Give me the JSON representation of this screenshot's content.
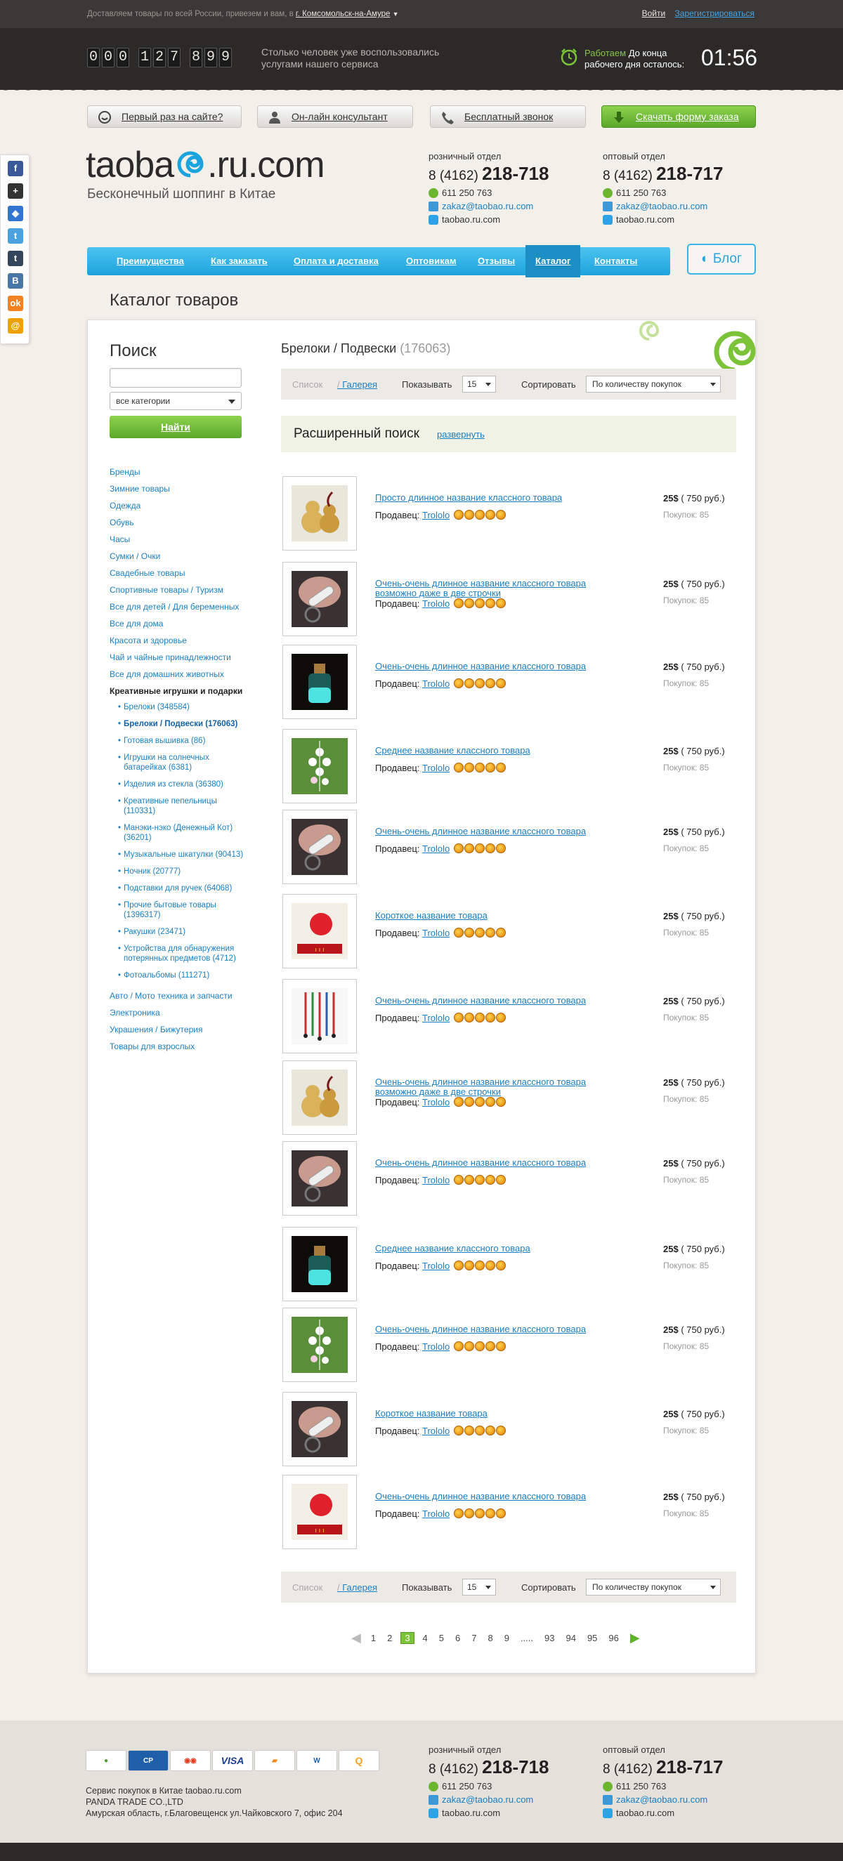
{
  "topbar": {
    "delivery_text": "Доставляем товары по всей России, привезем и вам, в",
    "city": "г. Комсомольск-на-Амуре",
    "login": "Войти",
    "register": "Зарегистрироваться"
  },
  "counter": {
    "digits": [
      "0",
      "0",
      "0",
      "1",
      "2",
      "7",
      "8",
      "9",
      "9"
    ],
    "text_line1": "Столько человек уже воспользовались",
    "text_line2": "услугами нашего сервиса",
    "work_status": "Работаем",
    "work_text_line1": "До конца",
    "work_text_line2": "рабочего дня осталось:",
    "timer": "01:56"
  },
  "quick_buttons": {
    "first_time": "Первый раз на сайте?",
    "consultant": "Он-лайн консультант",
    "free_call": "Бесплатный звонок",
    "order_form": "Скачать форму заказа"
  },
  "logo": {
    "text_before": "taoba",
    "text_after": ".ru.com",
    "tagline": "Бесконечный шоппинг в Китае"
  },
  "contacts": [
    {
      "label": "розничный отдел",
      "phone_prefix": "8 (4162)",
      "phone_main": "218-718",
      "icq": "611 250 763",
      "email": "zakaz@taobao.ru.com",
      "skype": "taobao.ru.com"
    },
    {
      "label": "оптовый отдел",
      "phone_prefix": "8 (4162)",
      "phone_main": "218-717",
      "icq": "611 250 763",
      "email": "zakaz@taobao.ru.com",
      "skype": "taobao.ru.com"
    }
  ],
  "nav": {
    "items": [
      "Преимущества",
      "Как заказать",
      "Оплата и доставка",
      "Оптовикам",
      "Отзывы",
      "Каталог",
      "Контакты"
    ],
    "active": "Каталог",
    "blog": "Блог"
  },
  "page_title": "Каталог товаров",
  "search": {
    "title": "Поиск",
    "input_value": "",
    "category": "все категории",
    "button": "Найти"
  },
  "categories": {
    "top": [
      "Бренды",
      "Зимние товары",
      "Одежда",
      "Обувь",
      "Часы",
      "Сумки / Очки",
      "Свадебные товары",
      "Спортивные товары / Туризм",
      "Все для детей / Для беременных",
      "Все для дома",
      "Красота и здоровье",
      "Чай и чайные принадлежности",
      "Все для домашних животных"
    ],
    "open": "Креативные игрушки и подарки",
    "subs": [
      "Брелоки (348584)",
      "Брелоки / Подвески (176063)",
      "Готовая вышивка (86)",
      "Игрушки на солнечных батарейках (6381)",
      "Изделия из стекла (36380)",
      "Креативные пепельницы (110331)",
      "Манэки-нэко (Денежный Кот) (36201)",
      "Музыкальные шкатулки (90413)",
      "Ночник (20777)",
      "Подставки для ручек (64068)",
      "Прочие бытовые товары (1396317)",
      "Ракушки (23471)",
      "Устройства для обнаружения потерянных предметов (4712)",
      "Фотоальбомы (111271)"
    ],
    "selected_sub": "Брелоки / Подвески (176063)",
    "bottom": [
      "Авто / Мото техника и запчасти",
      "Электроника",
      "Украшения / Бижутерия",
      "Товары для взрослых"
    ]
  },
  "catalog": {
    "heading": "Брелоки / Подвески",
    "count": "(176063)"
  },
  "sortbar": {
    "view_list": "Список",
    "view_gallery": "Галерея",
    "show_label": "Показывать",
    "show_value": "15",
    "sort_label": "Сортировать",
    "sort_value": "По количеству покупок"
  },
  "advanced_search": {
    "title": "Расширенный поиск",
    "expand": "развернуть"
  },
  "product_labels": {
    "seller": "Продавец:",
    "rub_before": "( 750 руб.)",
    "buys": "Покупок: 85"
  },
  "products": [
    {
      "name": "Просто длинное название классного товара",
      "seller": "Trololo",
      "price": "25$",
      "rub": "( 750 руб.)",
      "buys": "Покупок: 85",
      "rating": 5,
      "img": "gourd"
    },
    {
      "name": "Очень-очень длинное название классного товара возможно даже в две строчки",
      "seller": "Trololo",
      "price": "25$",
      "rub": "( 750 руб.)",
      "buys": "Покупок: 85",
      "rating": 5,
      "img": "hand"
    },
    {
      "name": "Очень-очень длинное название классного товара",
      "seller": "Trololo",
      "price": "25$",
      "rub": "( 750 руб.)",
      "buys": "Покупок: 85",
      "rating": 5,
      "img": "bottle"
    },
    {
      "name": "Среднее название классного товара",
      "seller": "Trololo",
      "price": "25$",
      "rub": "( 750 руб.)",
      "buys": "Покупок: 85",
      "rating": 5,
      "img": "flowers"
    },
    {
      "name": "Очень-очень длинное название классного товара",
      "seller": "Trololo",
      "price": "25$",
      "rub": "( 750 руб.)",
      "buys": "Покупок: 85",
      "rating": 5,
      "img": "hand"
    },
    {
      "name": "Короткое название товара",
      "seller": "Trololo",
      "price": "25$",
      "rub": "( 750 руб.)",
      "buys": "Покупок: 85",
      "rating": 5,
      "img": "pompom"
    },
    {
      "name": "Очень-очень длинное название классного товара",
      "seller": "Trololo",
      "price": "25$",
      "rub": "( 750 руб.)",
      "buys": "Покупок: 85",
      "rating": 5,
      "img": "cords"
    },
    {
      "name": "Очень-очень длинное название классного товара возможно даже в две строчки",
      "seller": "Trololo",
      "price": "25$",
      "rub": "( 750 руб.)",
      "buys": "Покупок: 85",
      "rating": 5,
      "img": "gourd"
    },
    {
      "name": "Очень-очень длинное название классного товара",
      "seller": "Trololo",
      "price": "25$",
      "rub": "( 750 руб.)",
      "buys": "Покупок: 85",
      "rating": 5,
      "img": "hand"
    },
    {
      "name": "Среднее название классного товара",
      "seller": "Trololo",
      "price": "25$",
      "rub": "( 750 руб.)",
      "buys": "Покупок: 85",
      "rating": 5,
      "img": "bottle"
    },
    {
      "name": "Очень-очень длинное название классного товара",
      "seller": "Trololo",
      "price": "25$",
      "rub": "( 750 руб.)",
      "buys": "Покупок: 85",
      "rating": 5,
      "img": "flowers"
    },
    {
      "name": "Короткое название товара",
      "seller": "Trololo",
      "price": "25$",
      "rub": "( 750 руб.)",
      "buys": "Покупок: 85",
      "rating": 5,
      "img": "hand"
    },
    {
      "name": "Очень-очень длинное название классного товара",
      "seller": "Trololo",
      "price": "25$",
      "rub": "( 750 руб.)",
      "buys": "Покупок: 85",
      "rating": 5,
      "img": "pompom"
    }
  ],
  "pagination": {
    "pages": [
      "1",
      "2",
      "3",
      "4",
      "5",
      "6",
      "7",
      "8",
      "9",
      ".....",
      "93",
      "94",
      "95",
      "96"
    ],
    "current": "3"
  },
  "footer": {
    "payments": [
      "WebMoney",
      "CyberPlat",
      "MasterCard",
      "VISA",
      "Яндекс.Деньги",
      "Western Union",
      "QIWI"
    ],
    "address_line1": "Сервис покупок в Китае taobao.ru.com",
    "address_line2": "PANDA TRADE CO.,LTD",
    "address_line3": "Амурская область, г.Благовещенск ул.Чайковского 7, офис 204"
  },
  "share": {
    "icons": [
      "facebook-icon",
      "plus-icon",
      "delicious-icon",
      "twitter-icon",
      "tumblr-icon",
      "vkontakte-icon",
      "odnoklassniki-icon",
      "mailru-icon"
    ]
  },
  "colors": {
    "accent_blue": "#1ea3dd",
    "accent_green": "#6bb52f",
    "dark_bar": "#2b2a29",
    "link": "#1a7fc4"
  }
}
